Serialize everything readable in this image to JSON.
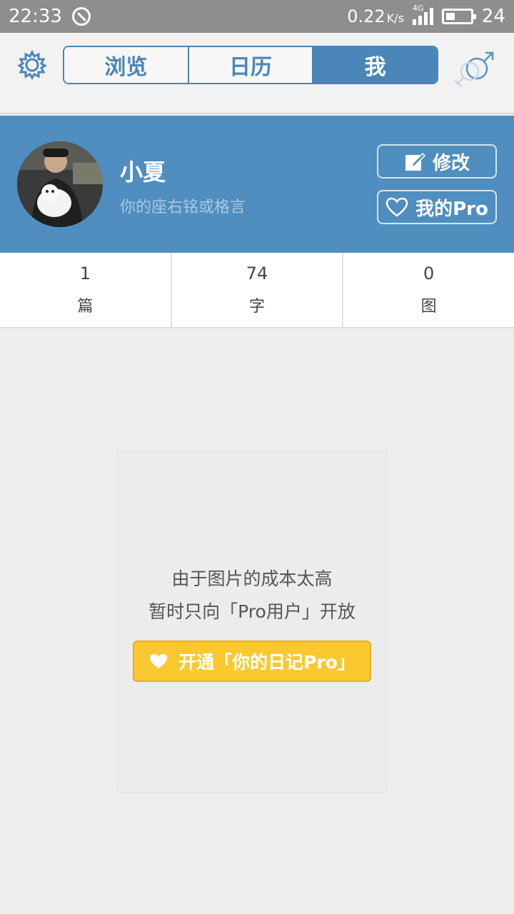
{
  "status_bar": {
    "time": "22:33",
    "net_speed": "0.22",
    "net_unit": "K/s",
    "network": "4G",
    "battery": "24"
  },
  "nav": {
    "tabs": [
      {
        "label": "浏览",
        "active": false
      },
      {
        "label": "日历",
        "active": false
      },
      {
        "label": "我",
        "active": true
      }
    ]
  },
  "profile": {
    "name": "小夏",
    "motto_placeholder": "你的座右铭或格言",
    "edit_label": "修改",
    "pro_label": "我的Pro"
  },
  "stats": [
    {
      "value": "1",
      "label": "篇"
    },
    {
      "value": "74",
      "label": "字"
    },
    {
      "value": "0",
      "label": "图"
    }
  ],
  "pro_notice": {
    "line1": "由于图片的成本太高",
    "line2": "暂时只向「Pro用户」开放",
    "button": "开通「你的日记Pro」"
  },
  "colors": {
    "accent": "#4a86b8",
    "banner": "#4f8ebf",
    "pro_button": "#fbc830"
  }
}
